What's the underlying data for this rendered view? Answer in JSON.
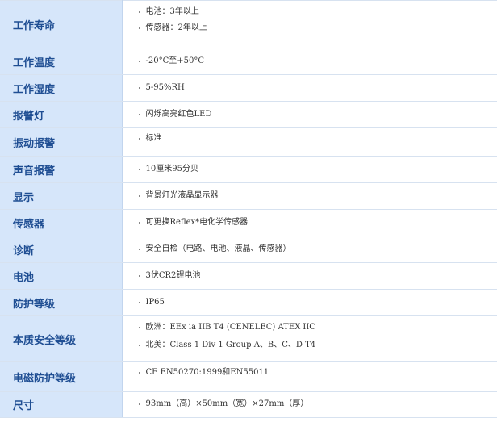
{
  "specs": [
    {
      "label": "工作寿命",
      "values": [
        "电池：3年以上",
        "传感器：2年以上"
      ]
    },
    {
      "label": "工作温度",
      "values": [
        "-20°C至+50°C"
      ]
    },
    {
      "label": "工作湿度",
      "values": [
        "5-95%RH"
      ]
    },
    {
      "label": "报警灯",
      "values": [
        "闪烁高亮红色LED"
      ]
    },
    {
      "label": "振动报警",
      "values": [
        "标准"
      ]
    },
    {
      "label": "声音报警",
      "values": [
        "10厘米95分贝"
      ]
    },
    {
      "label": "显示",
      "values": [
        "背景灯光液晶显示器"
      ]
    },
    {
      "label": "传感器",
      "values": [
        "可更换Reflex*电化学传感器"
      ]
    },
    {
      "label": "诊断",
      "values": [
        "安全自检（电路、电池、液晶、传感器）"
      ]
    },
    {
      "label": "电池",
      "values": [
        "3伏CR2锂电池"
      ]
    },
    {
      "label": "防护等级",
      "values": [
        "IP65"
      ]
    },
    {
      "label": "本质安全等级",
      "values": [
        "欧洲：EEx ia IIB T4 (CENELEC) ATEX IIC",
        "北美：Class 1 Div 1 Group A、B、C、D T4"
      ]
    },
    {
      "label": "电磁防护等级",
      "values": [
        "CE EN50270:1999和EN55011"
      ]
    },
    {
      "label": "尺寸",
      "values": [
        "93mm（高）×50mm（宽）×27mm（厚）"
      ]
    }
  ]
}
